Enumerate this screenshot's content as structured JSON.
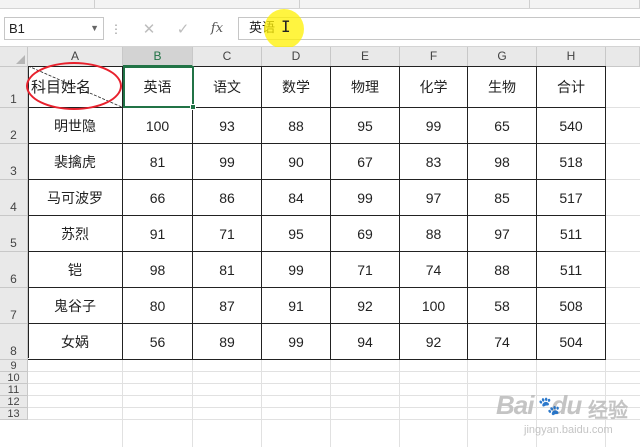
{
  "formula_bar": {
    "name_box": "B1",
    "cancel_icon": "close-icon",
    "enter_icon": "check-icon",
    "function_label": "fx",
    "content": "英语"
  },
  "columns": [
    "A",
    "B",
    "C",
    "D",
    "E",
    "F",
    "G",
    "H"
  ],
  "rows": [
    "1",
    "2",
    "3",
    "4",
    "5",
    "6",
    "7",
    "8",
    "9",
    "10",
    "11",
    "12",
    "13"
  ],
  "header_cell": {
    "left_part": "科目",
    "right_part": "姓名"
  },
  "subjects": [
    "英语",
    "语文",
    "数学",
    "物理",
    "化学",
    "生物",
    "合计"
  ],
  "students": [
    {
      "name": "明世隐",
      "scores": [
        "100",
        "93",
        "88",
        "95",
        "99",
        "65",
        "540"
      ]
    },
    {
      "name": "裴擒虎",
      "scores": [
        "81",
        "99",
        "90",
        "67",
        "83",
        "98",
        "518"
      ]
    },
    {
      "name": "马可波罗",
      "scores": [
        "66",
        "86",
        "84",
        "99",
        "97",
        "85",
        "517"
      ]
    },
    {
      "name": "苏烈",
      "scores": [
        "91",
        "71",
        "95",
        "69",
        "88",
        "97",
        "511"
      ]
    },
    {
      "name": "铠",
      "scores": [
        "98",
        "81",
        "99",
        "71",
        "74",
        "88",
        "511"
      ]
    },
    {
      "name": "鬼谷子",
      "scores": [
        "80",
        "87",
        "91",
        "92",
        "100",
        "58",
        "508"
      ]
    },
    {
      "name": "女娲",
      "scores": [
        "56",
        "89",
        "99",
        "94",
        "92",
        "74",
        "504"
      ]
    }
  ],
  "selected_column": "B",
  "accent_color": "#217346",
  "annotation_color": "#e8212d",
  "watermark": {
    "logo": "Bai",
    "logo_end": "du",
    "label": "经验",
    "url": "jingyan.baidu.com"
  }
}
